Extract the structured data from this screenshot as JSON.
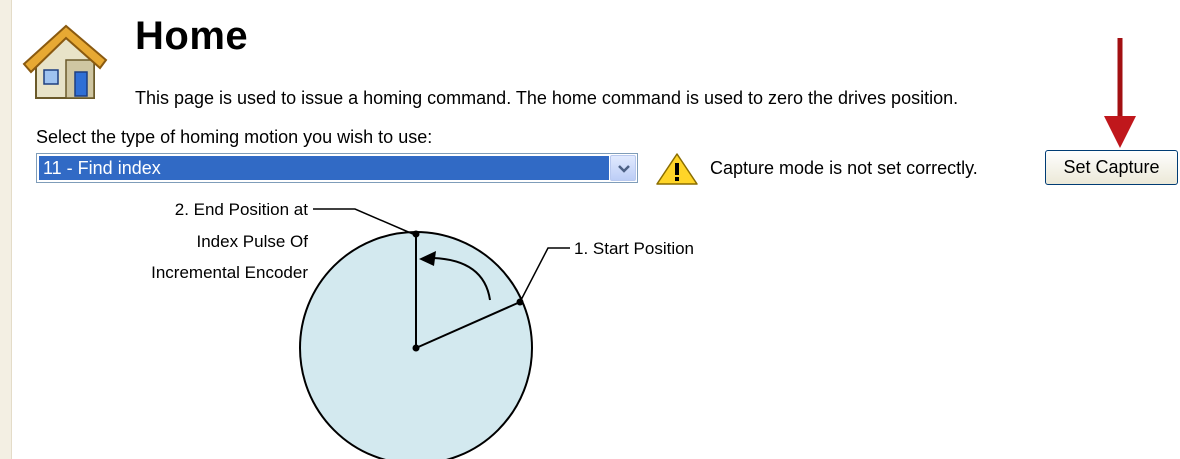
{
  "page": {
    "title": "Home",
    "description": "This page is used to issue a homing command. The home command is used to zero the drives position.",
    "icon": "home-icon"
  },
  "homing": {
    "select_label": "Select the type of homing motion you wish to use:",
    "selected_option": "11 - Find index"
  },
  "warning": {
    "icon": "warning-icon",
    "text": "Capture mode is not set correctly."
  },
  "set_capture": {
    "label": "Set Capture"
  },
  "diagram": {
    "end_label_line1": "2. End Position at",
    "end_label_line2": "Index Pulse Of",
    "end_label_line3": "Incremental Encoder",
    "start_label": "1. Start Position",
    "disc_color": "#d3e9ef"
  },
  "colors": {
    "selection": "#316ac5",
    "annotation_arrow": "#c0171c"
  }
}
